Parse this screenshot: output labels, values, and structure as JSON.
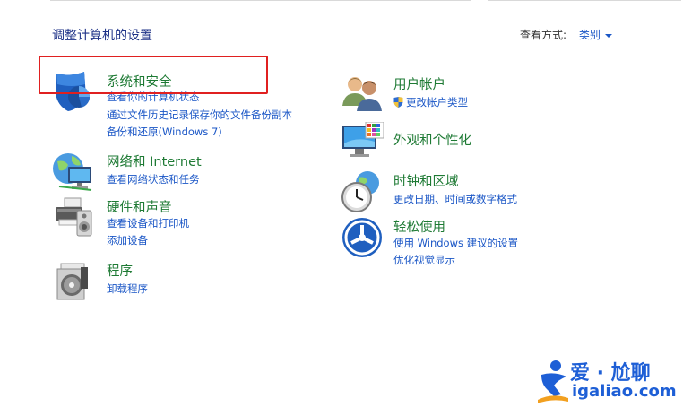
{
  "header": {
    "title": "调整计算机的设置",
    "view_by_label": "查看方式:",
    "view_by_value": "类别"
  },
  "categories_left": [
    {
      "title": "系统和安全",
      "links": [
        "查看你的计算机状态",
        "通过文件历史记录保存你的文件备份副本",
        "备份和还原(Windows 7)"
      ],
      "icon": "shield-icon"
    },
    {
      "title": "网络和 Internet",
      "links": [
        "查看网络状态和任务"
      ],
      "icon": "network-globe-icon"
    },
    {
      "title": "硬件和声音",
      "links": [
        "查看设备和打印机",
        "添加设备"
      ],
      "icon": "printer-speaker-icon"
    },
    {
      "title": "程序",
      "links": [
        "卸载程序"
      ],
      "icon": "programs-disc-icon"
    }
  ],
  "categories_right": [
    {
      "title": "用户帐户",
      "links": [
        "更改帐户类型"
      ],
      "icon": "users-icon"
    },
    {
      "title": "外观和个性化",
      "links": [],
      "icon": "monitor-palette-icon"
    },
    {
      "title": "时钟和区域",
      "links": [
        "更改日期、时间或数字格式"
      ],
      "icon": "clock-globe-icon"
    },
    {
      "title": "轻松使用",
      "links": [
        "使用 Windows 建议的设置",
        "优化视觉显示"
      ],
      "icon": "ease-of-access-icon"
    }
  ],
  "watermark": {
    "brand": "爱 · 尬聊",
    "url": "igaliao.com"
  },
  "colors": {
    "category_title": "#1e7a34",
    "link": "#1a56c6",
    "highlight_border": "#e02020",
    "watermark": "#1e5fd6"
  }
}
